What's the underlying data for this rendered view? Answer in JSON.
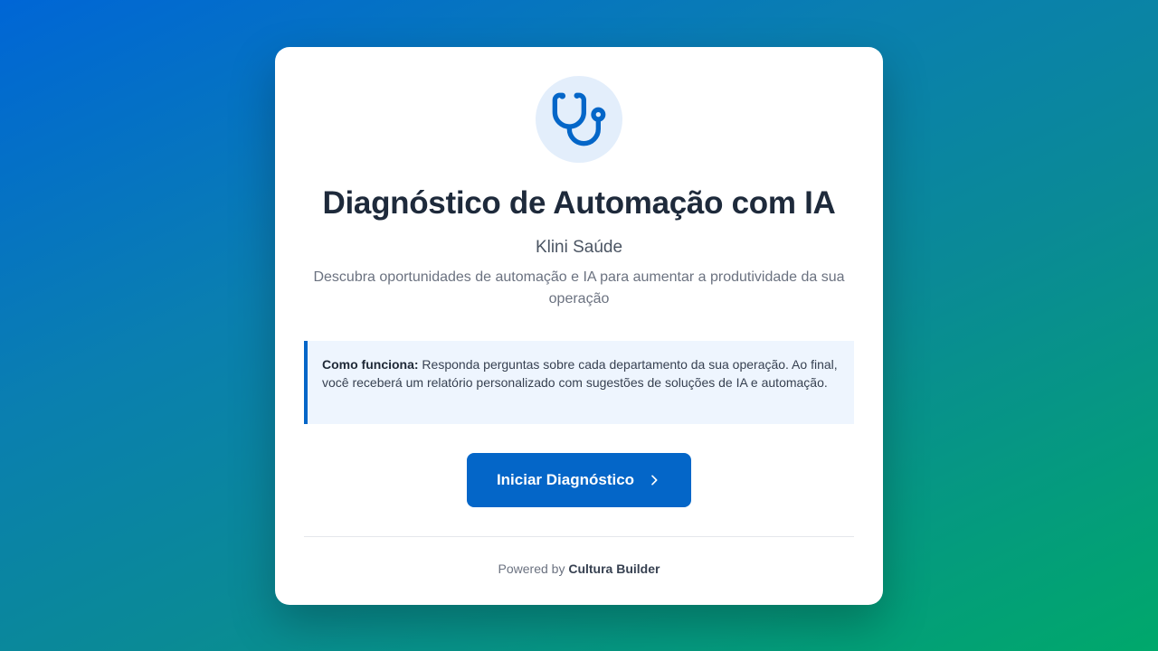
{
  "header": {
    "icon": "stethoscope-icon",
    "title": "Diagnóstico de Automação com IA",
    "company": "Klini Saúde",
    "description": "Descubra oportunidades de automação e IA para aumentar a produtividade da sua operação"
  },
  "info": {
    "label": "Como funciona:",
    "text": " Responda perguntas sobre cada departamento da sua operação. Ao final, você receberá um relatório personalizado com sugestões de soluções de IA e automação."
  },
  "actions": {
    "start_label": "Iniciar Diagnóstico",
    "start_icon": "chevron-right-icon"
  },
  "footer": {
    "prefix": "Powered by ",
    "brand": "Cultura Builder"
  },
  "colors": {
    "accent": "#0466c8",
    "icon_bg": "#e3eefb",
    "info_bg": "#eef5fe",
    "title": "#1e2a3b"
  }
}
